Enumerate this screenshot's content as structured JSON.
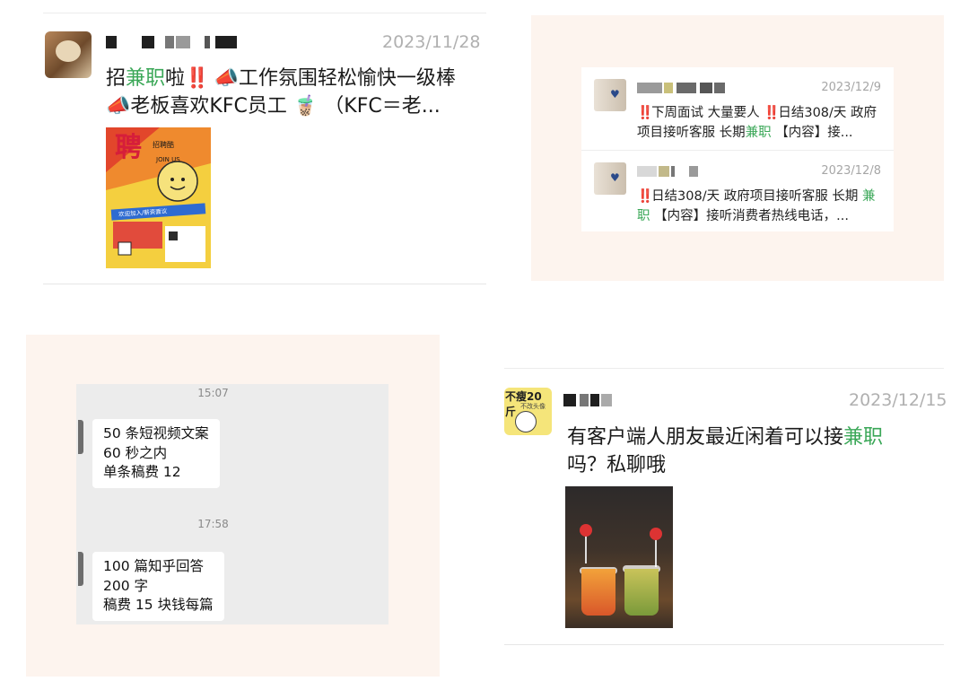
{
  "moments_post_1": {
    "date": "2023/11/28",
    "text_parts": {
      "a": "招",
      "b": "兼职",
      "c": "啦",
      "d": "‼️",
      "e": "📣",
      "f": "工作氛围轻松愉快一级棒 ",
      "g": "📣",
      "h": "老板喜欢KFC员工",
      "i": "🧋",
      "j": "（KFC＝老..."
    },
    "poster_text": {
      "big": "聘",
      "line": "招聘酷",
      "join": "JOIN US",
      "strip": "欢迎加入/薪资面议"
    }
  },
  "search_results": {
    "item1": {
      "date": "2023/12/9",
      "text_parts": {
        "a": "‼️",
        "b": "下周面试 大量要人 ",
        "c": "‼️",
        "d": "日结308/天 政府项目接听客服 长期",
        "e": "兼职",
        "f": " 【内容】接..."
      }
    },
    "item2": {
      "date": "2023/12/8",
      "text_parts": {
        "a": "‼️",
        "b": "日结308/天 政府项目接听客服 长期 ",
        "c": "兼职",
        "d": " 【内容】接听消费者热线电话，..."
      }
    }
  },
  "chat": {
    "messages": [
      {
        "time": "15:07",
        "lines": [
          "50 条短视频文案",
          "60 秒之内",
          "单条稿费 12"
        ]
      },
      {
        "time": "17:58",
        "lines": [
          "100 篇知乎回答",
          "200 字",
          "稿费 15 块钱每篇"
        ]
      }
    ]
  },
  "moments_post_2": {
    "avatar_text": "不瘦20斤",
    "avatar_sub": "不改头像",
    "date": "2023/12/15",
    "text_parts": {
      "a": "有客户端人朋友最近闲着可以接",
      "b": "兼职",
      "c": "吗？私聊哦"
    }
  },
  "colors": {
    "highlight": "#3aa757",
    "panel_bg": "#fdf4ee",
    "chat_bg": "#ececec",
    "date_gray": "#b0b0b0"
  }
}
